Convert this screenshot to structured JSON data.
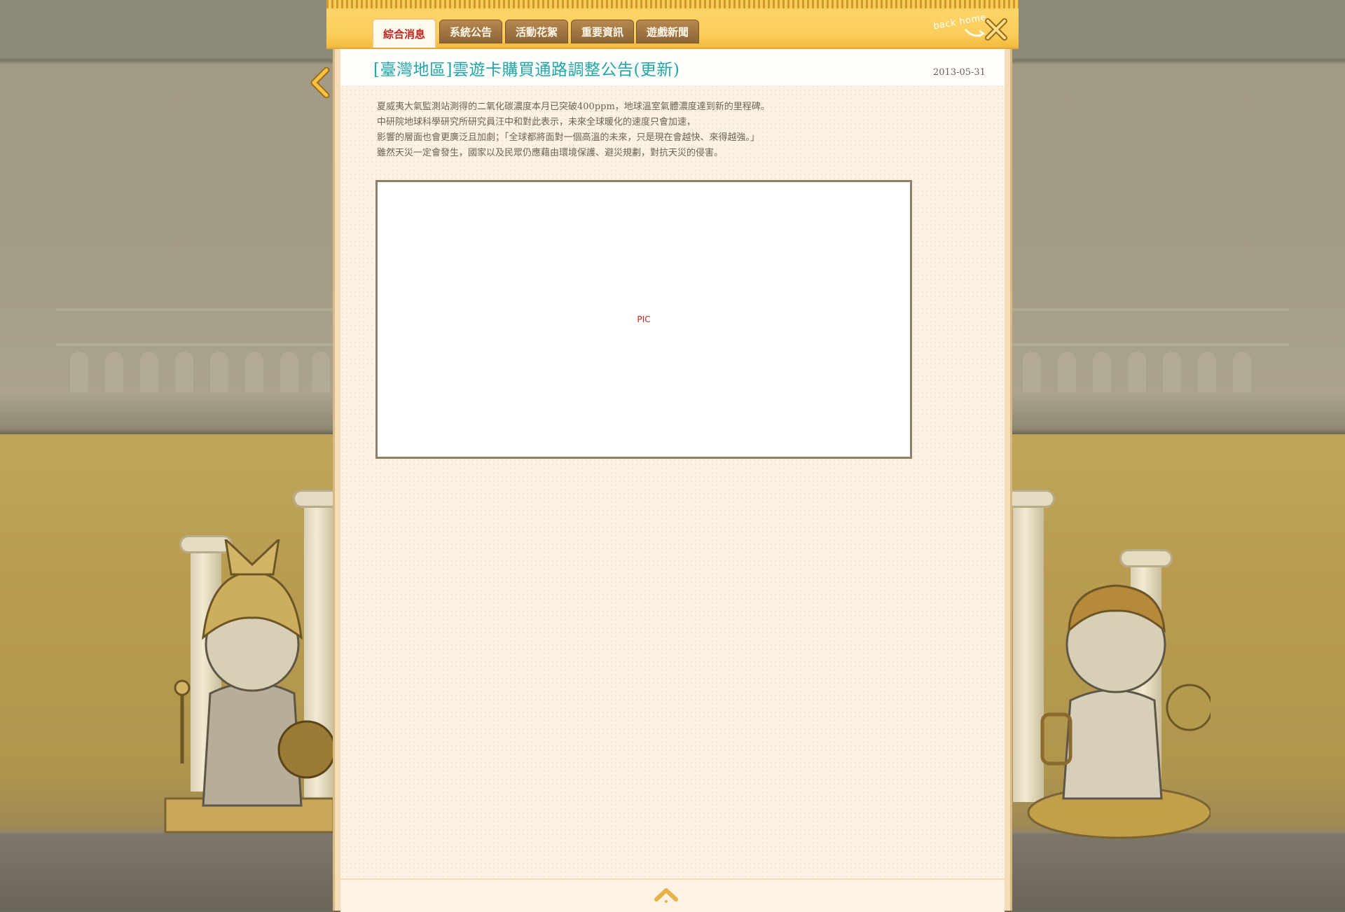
{
  "tabs": [
    {
      "label": "綜合消息",
      "active": true
    },
    {
      "label": "系統公告",
      "active": false
    },
    {
      "label": "活動花絮",
      "active": false
    },
    {
      "label": "重要資訊",
      "active": false
    },
    {
      "label": "遊戲新聞",
      "active": false
    }
  ],
  "header": {
    "back_home_label": "back home",
    "close_icon": "close-x-icon"
  },
  "article": {
    "title": "[臺灣地區]雲遊卡購買通路調整公告(更新)",
    "date": "2013-05-31",
    "paragraphs": [
      "夏威夷大氣監測站測得的二氧化碳濃度本月已突破400ppm，地球溫室氣體濃度達到新的里程碑。",
      "中研院地球科學研究所研究員汪中和對此表示，未來全球暖化的速度只會加速，",
      "影響的層面也會更廣泛且加劇；「全球都將面對一個高溫的未來，只是現在會越快、來得越強。」",
      "雖然天災一定會發生，國家以及民眾仍應藉由環境保護、避災規劃，對抗天災的侵害。"
    ],
    "image_placeholder": "PIC"
  },
  "icons": {
    "prev": "chevron-left-icon",
    "top": "chevron-up-icon"
  },
  "colors": {
    "title": "#1fa7ac",
    "active_tab_text": "#c2261f",
    "header_bar": "#f6c343",
    "panel": "#fdf2e3"
  }
}
